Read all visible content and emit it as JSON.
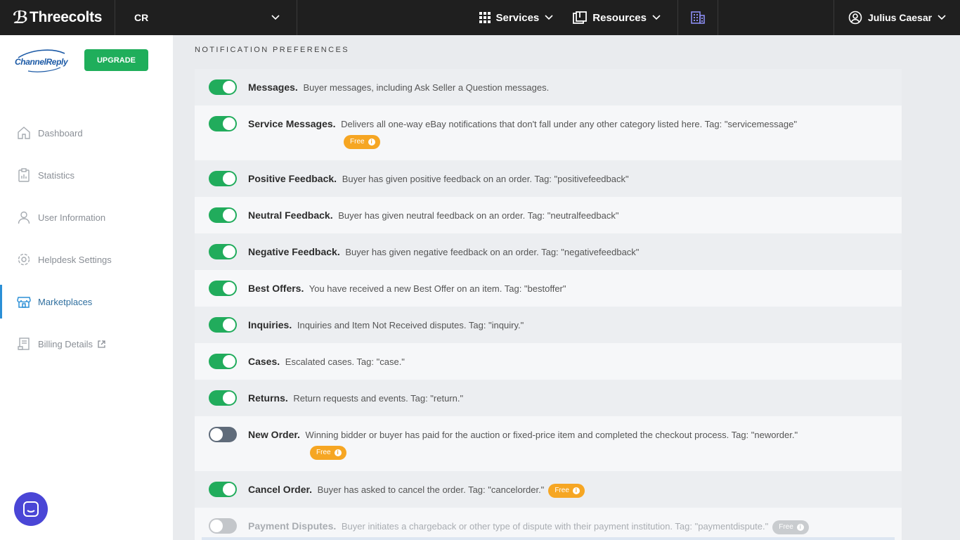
{
  "topbar": {
    "brand": "Threecolts",
    "org": "CR",
    "nav": [
      {
        "label": "Services",
        "icon": "grid-icon"
      },
      {
        "label": "Resources",
        "icon": "books-icon"
      }
    ],
    "user": "Julius Caesar",
    "accent": "#8b8cf0"
  },
  "sidebar": {
    "logo_text": "ChannelReply",
    "upgrade_label": "UPGRADE",
    "items": [
      {
        "label": "Dashboard",
        "icon": "home-icon"
      },
      {
        "label": "Statistics",
        "icon": "clipboard-icon"
      },
      {
        "label": "User Information",
        "icon": "user-icon"
      },
      {
        "label": "Helpdesk Settings",
        "icon": "gear-icon"
      },
      {
        "label": "Marketplaces",
        "icon": "store-icon",
        "active": true
      },
      {
        "label": "Billing Details",
        "icon": "receipt-icon"
      }
    ]
  },
  "main": {
    "section_title": "NOTIFICATION PREFERENCES",
    "free_label": "Free",
    "notifications": [
      {
        "name": "Messages.",
        "desc": "Buyer messages, including Ask Seller a Question messages.",
        "state": "on",
        "free": false
      },
      {
        "name": "Service Messages.",
        "desc": "Delivers all one-way eBay notifications that don't fall under any other category listed here. Tag: \"servicemessage\"",
        "state": "on",
        "free": "newline"
      },
      {
        "name": "Positive Feedback.",
        "desc": "Buyer has given positive feedback on an order. Tag: \"positivefeedback\"",
        "state": "on",
        "free": false
      },
      {
        "name": "Neutral Feedback.",
        "desc": "Buyer has given neutral feedback on an order. Tag: \"neutralfeedback\"",
        "state": "on",
        "free": false
      },
      {
        "name": "Negative Feedback.",
        "desc": "Buyer has given negative feedback on an order. Tag: \"negativefeedback\"",
        "state": "on",
        "free": false
      },
      {
        "name": "Best Offers.",
        "desc": "You have received a new Best Offer on an item. Tag: \"bestoffer\"",
        "state": "on",
        "free": false
      },
      {
        "name": "Inquiries.",
        "desc": "Inquiries and Item Not Received disputes. Tag: \"inquiry.\"",
        "state": "on",
        "free": false
      },
      {
        "name": "Cases.",
        "desc": "Escalated cases. Tag: \"case.\"",
        "state": "on",
        "free": false
      },
      {
        "name": "Returns.",
        "desc": "Return requests and events. Tag: \"return.\"",
        "state": "on",
        "free": false
      },
      {
        "name": "New Order.",
        "desc": "Winning bidder or buyer has paid for the auction or fixed-price item and completed the checkout process. Tag: \"neworder.\"",
        "state": "off",
        "free": "newline"
      },
      {
        "name": "Cancel Order.",
        "desc": "Buyer has asked to cancel the order. Tag: \"cancelorder.\"",
        "state": "on",
        "free": "inline"
      },
      {
        "name": "Payment Disputes.",
        "desc": "Buyer initiates a chargeback or other type of dispute with their payment institution. Tag: \"paymentdispute.\"",
        "state": "disabled",
        "free": "inline"
      }
    ]
  }
}
